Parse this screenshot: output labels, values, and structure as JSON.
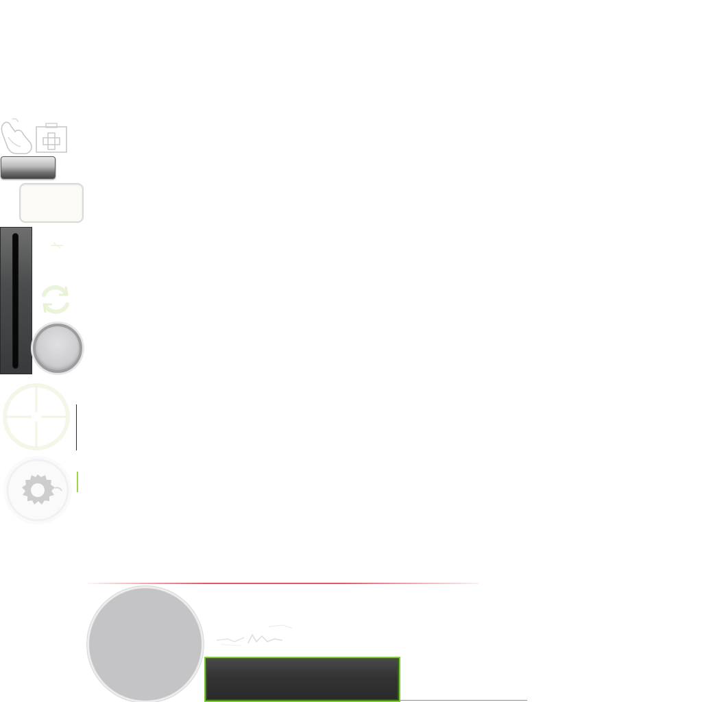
{
  "window": {
    "title": ""
  },
  "toolbar": {
    "icons": [
      "hand-pointer-icon",
      "medkit-icon"
    ],
    "dark_button_label": "",
    "text_panel_value": ""
  },
  "controls": {
    "vertical_slider": {
      "value": 0
    },
    "round_knob": {
      "label": ""
    },
    "icons": [
      "refresh-icon",
      "crosshair-icon",
      "gear-icon"
    ]
  },
  "bottom_panel": {
    "caption_text": "",
    "status_panel_text": ""
  },
  "colors": {
    "accent_green": "#7cc83a",
    "accent_red": "#de3c48",
    "slider_dark": "#373b3b",
    "knob_grey": "#cfcfd2",
    "circle_grey": "#c4c4c6",
    "panel_dark": "#333333",
    "cream": "#fcfaf6"
  }
}
